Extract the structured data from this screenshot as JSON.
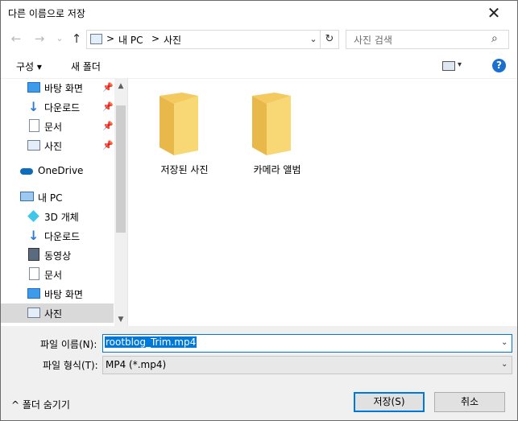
{
  "window": {
    "title": "다른 이름으로 저장",
    "close_glyph": "✕"
  },
  "nav": {
    "back": "←",
    "forward": "→",
    "recent": "⌄",
    "up": "↑",
    "breadcrumb": [
      ">",
      "내 PC",
      ">",
      "사진"
    ],
    "address_dropdown": "⌄",
    "refresh": "↻",
    "search_placeholder": "사진 검색",
    "search_icon": "⌕"
  },
  "toolbar": {
    "organize": "구성 ▾",
    "new_folder": "새 폴더",
    "view": "▾",
    "help": "?"
  },
  "sidebar": {
    "items": [
      {
        "label": "바탕 화면",
        "icon": "desktop-icon",
        "pinned": true
      },
      {
        "label": "다운로드",
        "icon": "download-icon",
        "pinned": true
      },
      {
        "label": "문서",
        "icon": "document-icon",
        "pinned": true
      },
      {
        "label": "사진",
        "icon": "pictures-icon",
        "pinned": true
      },
      {
        "label": "OneDrive",
        "icon": "onedrive-icon",
        "pinned": false
      },
      {
        "label": "내 PC",
        "icon": "pc-icon",
        "pinned": false
      },
      {
        "label": "3D 개체",
        "icon": "3d-objects-icon",
        "pinned": false
      },
      {
        "label": "다운로드",
        "icon": "download-icon",
        "pinned": false
      },
      {
        "label": "동영상",
        "icon": "video-icon",
        "pinned": false
      },
      {
        "label": "문서",
        "icon": "document-icon",
        "pinned": false
      },
      {
        "label": "바탕 화면",
        "icon": "desktop-icon",
        "pinned": false
      },
      {
        "label": "사진",
        "icon": "pictures-icon",
        "pinned": false,
        "selected": true
      }
    ],
    "scroll_up": "▲",
    "scroll_down": "▼",
    "pin_glyph": "📌"
  },
  "content": {
    "folders": [
      {
        "name": "저장된 사진"
      },
      {
        "name": "카메라 앨범"
      }
    ]
  },
  "form": {
    "filename_label": "파일 이름(N):",
    "filename_value": "rootblog_Trim.mp4",
    "filetype_label": "파일 형식(T):",
    "filetype_value": "MP4 (*.mp4)",
    "hide_folders": "^ 폴더 숨기기",
    "save": "저장(S)",
    "cancel": "취소"
  },
  "colors": {
    "accent": "#0078d7",
    "folder": "#f8d775",
    "selected": "#d9d9d9"
  }
}
